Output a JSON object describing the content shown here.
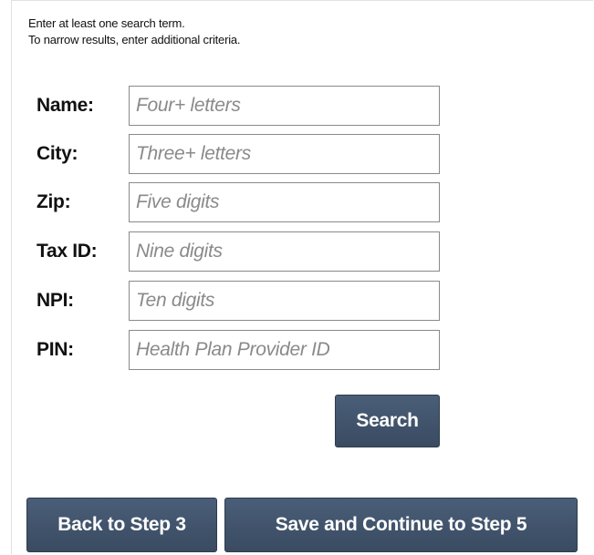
{
  "instructions": {
    "line1": "Enter at least one search term.",
    "line2": "To narrow results, enter additional criteria."
  },
  "fields": [
    {
      "label": "Name:",
      "placeholder": "Four+ letters",
      "value": ""
    },
    {
      "label": "City:",
      "placeholder": "Three+ letters",
      "value": ""
    },
    {
      "label": "Zip:",
      "placeholder": "Five digits",
      "value": ""
    },
    {
      "label": "Tax ID:",
      "placeholder": "Nine digits",
      "value": ""
    },
    {
      "label": "NPI:",
      "placeholder": "Ten digits",
      "value": ""
    },
    {
      "label": "PIN:",
      "placeholder": "Health Plan Provider ID",
      "value": ""
    }
  ],
  "actions": {
    "search_label": "Search",
    "back_label": "Back to Step 3",
    "save_continue_label": "Save and Continue to Step 5"
  },
  "colors": {
    "button_bg": "#3f5168",
    "button_text": "#ffffff",
    "input_border": "#8a8a8a",
    "placeholder_text": "#8a8a8a"
  }
}
